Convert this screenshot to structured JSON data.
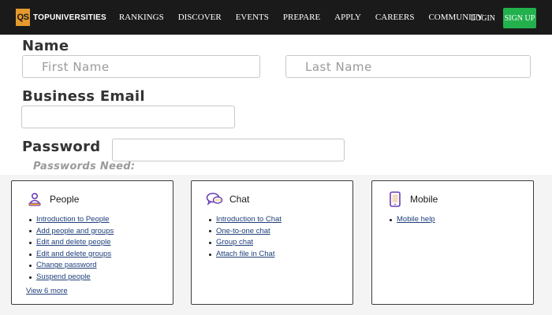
{
  "nav": {
    "brand_mark": "QS",
    "brand_name": "TOPUNIVERSITIES",
    "links": [
      "RANKINGS",
      "DISCOVER",
      "EVENTS",
      "PREPARE",
      "APPLY",
      "CAREERS",
      "COMMUNITY"
    ],
    "login": "LOGIN",
    "signup": "SIGN UP",
    "colors": {
      "bar": "#1a1a1a",
      "brand_accent": "#e59a2e",
      "signup": "#23b14d"
    }
  },
  "form": {
    "name_label": "Name",
    "first_name_placeholder": "First Name",
    "last_name_placeholder": "Last Name",
    "email_label": "Business Email",
    "email_value": "",
    "password_label": "Password",
    "password_value": "",
    "password_hint": "Passwords Need:"
  },
  "cards": [
    {
      "title": "People",
      "icon": "people-icon",
      "items": [
        "Introduction to People",
        "Add people and groups",
        "Edit and delete people",
        "Edit and delete groups",
        "Change password",
        "Suspend people"
      ],
      "view_more": "View 6 more"
    },
    {
      "title": "Chat",
      "icon": "chat-icon",
      "items": [
        "Introduction to Chat",
        "One-to-one chat",
        "Group chat",
        "Attach file in Chat"
      ]
    },
    {
      "title": "Mobile",
      "icon": "mobile-icon",
      "items": [
        "Mobile help"
      ]
    }
  ],
  "accent_color": "#6a3fb5"
}
